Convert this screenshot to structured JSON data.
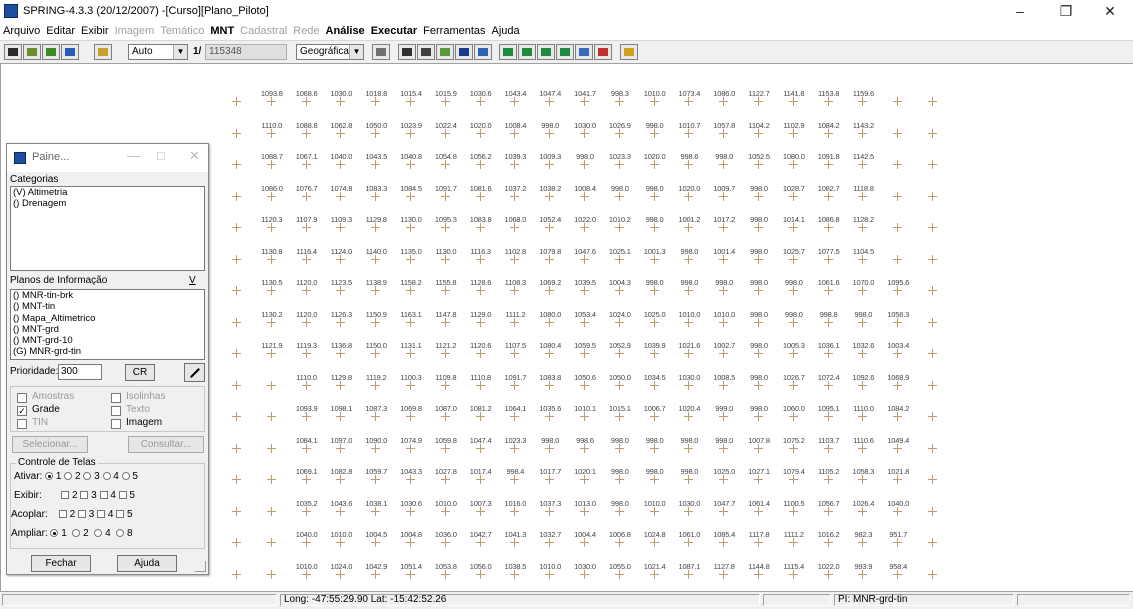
{
  "window": {
    "title": "SPRING-4.3.3 (20/12/2007) -[Curso][Plano_Piloto]",
    "minimize": "–",
    "maximize": "❐",
    "close": "✕"
  },
  "menu": [
    {
      "label": "Arquivo",
      "state": "normal"
    },
    {
      "label": "Editar",
      "state": "normal"
    },
    {
      "label": "Exibir",
      "state": "normal"
    },
    {
      "label": "Imagem",
      "state": "disabled"
    },
    {
      "label": "Temático",
      "state": "disabled"
    },
    {
      "label": "MNT",
      "state": "bold"
    },
    {
      "label": "Cadastral",
      "state": "disabled"
    },
    {
      "label": "Rede",
      "state": "disabled"
    },
    {
      "label": "Análise",
      "state": "bold"
    },
    {
      "label": "Executar",
      "state": "bold"
    },
    {
      "label": "Ferramentas",
      "state": "normal"
    },
    {
      "label": "Ajuda",
      "state": "normal"
    }
  ],
  "toolbar": {
    "zoom_mode": "Auto",
    "scale_prefix": "1/",
    "scale_value": "115348",
    "projection": "Geográficas",
    "icons": [
      "view-icon",
      "legend-icon",
      "color-icon",
      "draw-icon",
      "tool-icon",
      "grid-icon",
      "pan-icon",
      "add-icon",
      "zoom-icon",
      "info-icon",
      "cursor-icon",
      "line-icon",
      "measure-icon",
      "edit-icon",
      "split-icon",
      "back-icon",
      "forward-icon",
      "help-icon"
    ]
  },
  "grid": {
    "rows": [
      [
        "",
        "1093.8",
        "1068.6",
        "1030.0",
        "1018.8",
        "1015.4",
        "1015.9",
        "1030.6",
        "1043.4",
        "1047.4",
        "1041.7",
        "998.3",
        "1010.0",
        "1073.4",
        "1086.0",
        "1122.7",
        "1141.8",
        "1153.8",
        "1159.6",
        "",
        ""
      ],
      [
        "",
        "1110.0",
        "1088.8",
        "1062.8",
        "1050.0",
        "1023.9",
        "1022.4",
        "1020.0",
        "1008.4",
        "998.0",
        "1030.0",
        "1026.9",
        "998.0",
        "1010.7",
        "1057.8",
        "1104.2",
        "1102.9",
        "1084.2",
        "1143.2",
        "",
        ""
      ],
      [
        "",
        "1088.7",
        "1067.1",
        "1040.0",
        "1043.5",
        "1040.8",
        "1054.8",
        "1056.2",
        "1039.3",
        "1009.3",
        "998.0",
        "1023.3",
        "1020.0",
        "998.6",
        "998.0",
        "1052.5",
        "1080.0",
        "1091.8",
        "1142.5",
        "",
        ""
      ],
      [
        "",
        "1086.0",
        "1076.7",
        "1074.8",
        "1083.3",
        "1084.5",
        "1091.7",
        "1081.6",
        "1037.2",
        "1038.2",
        "1008.4",
        "998.0",
        "998.0",
        "1020.0",
        "1009.7",
        "998.0",
        "1028.7",
        "1082.7",
        "1118.8",
        "",
        ""
      ],
      [
        "",
        "1120.3",
        "1107.9",
        "1109.3",
        "1129.8",
        "1130.0",
        "1095.3",
        "1083.8",
        "1068.0",
        "1052.4",
        "1022.0",
        "1010.2",
        "998.0",
        "1001.2",
        "1017.2",
        "998.0",
        "1014.1",
        "1086.8",
        "1128.2",
        "",
        ""
      ],
      [
        "",
        "1130.8",
        "1116.4",
        "1124.0",
        "1140.0",
        "1135.0",
        "1130.0",
        "1116.3",
        "1102.8",
        "1079.8",
        "1047.6",
        "1025.1",
        "1001.3",
        "998.0",
        "1001.4",
        "998.0",
        "1025.7",
        "1077.5",
        "1104.5",
        "",
        ""
      ],
      [
        "",
        "1130.5",
        "1120.0",
        "1123.5",
        "1138.9",
        "1158.2",
        "1155.8",
        "1128.6",
        "1108.3",
        "1069.2",
        "1039.5",
        "1004.3",
        "998.0",
        "998.0",
        "998.0",
        "998.0",
        "998.0",
        "1061.6",
        "1070.0",
        "1095.6",
        ""
      ],
      [
        "",
        "1130.2",
        "1120.0",
        "1126.3",
        "1150.9",
        "1163.1",
        "1147.8",
        "1129.0",
        "1111.2",
        "1080.0",
        "1053.4",
        "1024.0",
        "1025.0",
        "1010.0",
        "1010.0",
        "998.0",
        "998.0",
        "998.8",
        "998.0",
        "1056.3",
        ""
      ],
      [
        "",
        "1121.9",
        "1119.3",
        "1136.8",
        "1150.0",
        "1131.1",
        "1121.2",
        "1120.6",
        "1107.5",
        "1080.4",
        "1059.5",
        "1052.9",
        "1039.9",
        "1021.6",
        "1002.7",
        "998.0",
        "1005.3",
        "1036.1",
        "1032.6",
        "1003.4",
        ""
      ],
      [
        "",
        "",
        "1110.0",
        "1129.8",
        "1119.2",
        "1100.3",
        "1109.8",
        "1110.8",
        "1091.7",
        "1083.8",
        "1050.6",
        "1050.0",
        "1034.5",
        "1030.0",
        "1008.5",
        "998.0",
        "1026.7",
        "1072.4",
        "1092.6",
        "1068.9",
        ""
      ],
      [
        "",
        "",
        "1093.9",
        "1098.1",
        "1087.3",
        "1069.8",
        "1087.0",
        "1081.2",
        "1064.1",
        "1035.6",
        "1010.1",
        "1015.1",
        "1006.7",
        "1020.4",
        "999.0",
        "998.0",
        "1060.0",
        "1095.1",
        "1110.0",
        "1084.2",
        ""
      ],
      [
        "",
        "",
        "1084.1",
        "1097.0",
        "1090.0",
        "1074.9",
        "1059.8",
        "1047.4",
        "1023.3",
        "998.0",
        "998.6",
        "998.0",
        "998.0",
        "998.0",
        "998.0",
        "1007.8",
        "1075.2",
        "1103.7",
        "1110.6",
        "1049.4",
        ""
      ],
      [
        "",
        "",
        "1069.1",
        "1082.8",
        "1059.7",
        "1043.3",
        "1027.8",
        "1017.4",
        "998.4",
        "1017.7",
        "1020.1",
        "998.0",
        "998.0",
        "998.0",
        "1025.0",
        "1027.1",
        "1079.4",
        "1105.2",
        "1058.3",
        "1021.8",
        ""
      ],
      [
        "",
        "",
        "1035.2",
        "1043.6",
        "1038.1",
        "1030.6",
        "1010.0",
        "1007.3",
        "1016.0",
        "1037.3",
        "1013.0",
        "998.0",
        "1010.0",
        "1030.0",
        "1047.7",
        "1061.4",
        "1100.5",
        "1056.7",
        "1026.4",
        "1040.0",
        ""
      ],
      [
        "",
        "",
        "1040.0",
        "1010.0",
        "1004.5",
        "1004.8",
        "1036.0",
        "1042.7",
        "1041.3",
        "1032.7",
        "1004.4",
        "1006.8",
        "1024.8",
        "1061.0",
        "1085.4",
        "1117.8",
        "1111.2",
        "1016.2",
        "982.3",
        "951.7",
        ""
      ],
      [
        "",
        "",
        "1010.0",
        "1024.0",
        "1042.9",
        "1051.4",
        "1053.8",
        "1056.0",
        "1038.5",
        "1010.0",
        "1030.0",
        "1055.0",
        "1021.4",
        "1087.1",
        "1127.8",
        "1144.8",
        "1115.4",
        "1022.0",
        "993.9",
        "958.4",
        ""
      ]
    ]
  },
  "status": {
    "left": "",
    "coords": "Long: -47:55:29.90 Lat: -15:42:52.26",
    "middle": "",
    "plane": "PI: MNR-grd-tin"
  },
  "panel": {
    "title": "Paine...",
    "min": "—",
    "max": "□",
    "close": "✕",
    "categorias_label": "Categorias",
    "categorias": [
      "(V) Altimetria",
      "() Drenagem"
    ],
    "planos_label": "Planos de Informação",
    "planos_toggle": "V",
    "planos": [
      "() MNR-tin-brk",
      "() MNT-tin",
      "() Mapa_Altimetrico",
      "() MNT-grd",
      "() MNT-grd-10",
      "(G) MNR-grd-tin"
    ],
    "prioridade_label": "Prioridade:",
    "prioridade_value": "300",
    "cr_label": "CR",
    "amostras": "Amostras",
    "isolinhas": "Isolinhas",
    "grade": "Grade",
    "texto": "Texto",
    "tin": "TIN",
    "imagem": "Imagem",
    "selecionar": "Selecionar...",
    "consultar": "Consultar...",
    "controle_label": "Controle de Telas",
    "ativar_label": "Ativar:",
    "exibir_label": "Exibir:",
    "acoplar_label": "Acoplar:",
    "ampliar_label": "Ampliar:",
    "n1": "1",
    "n2": "2",
    "n3": "3",
    "n4": "4",
    "n5": "5",
    "n8": "8",
    "fechar": "Fechar",
    "ajuda": "Ajuda"
  }
}
